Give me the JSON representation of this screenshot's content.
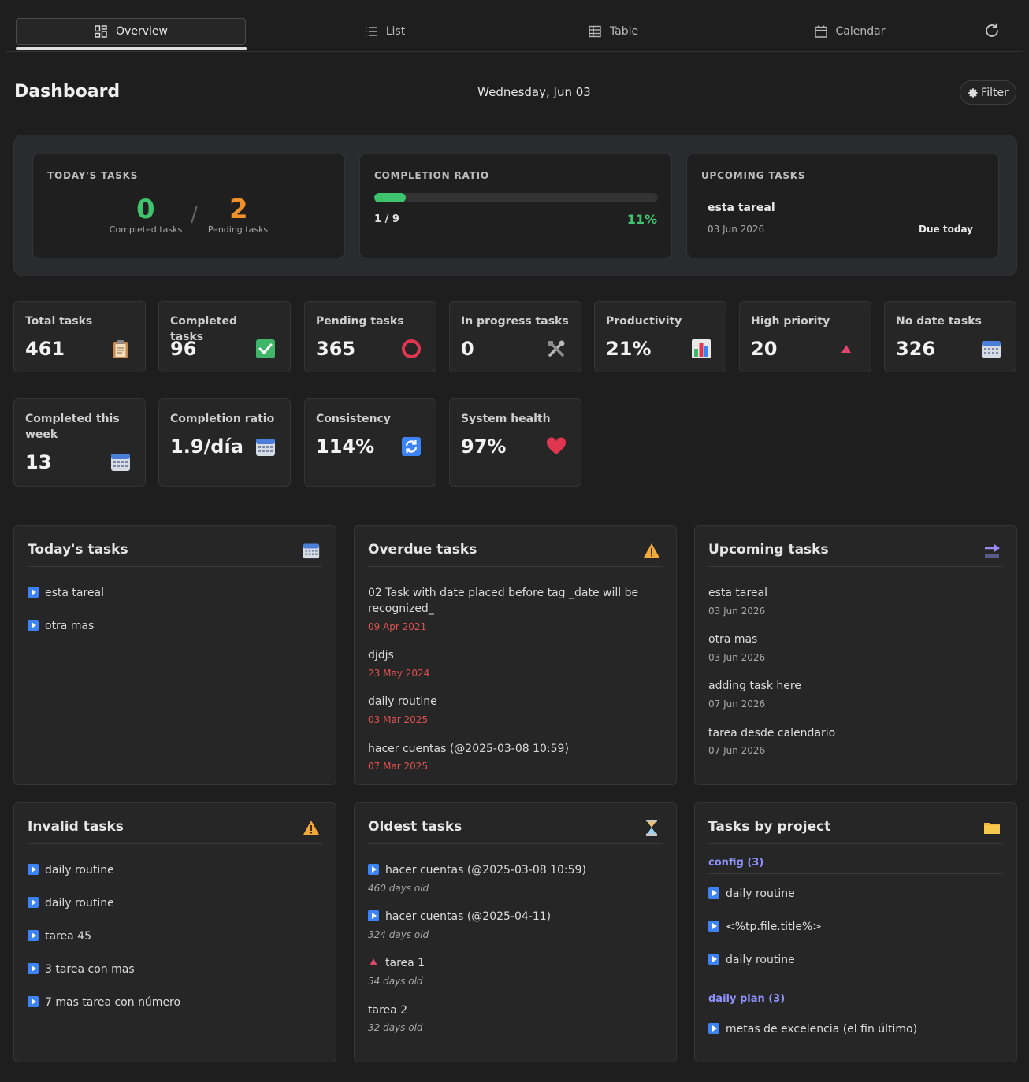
{
  "tabs": [
    {
      "label": "Overview",
      "icon": "grid-icon"
    },
    {
      "label": "List",
      "icon": "list-icon"
    },
    {
      "label": "Table",
      "icon": "table-icon"
    },
    {
      "label": "Calendar",
      "icon": "calendar-icon"
    }
  ],
  "header": {
    "title": "Dashboard",
    "date": "Wednesday, Jun 03",
    "filter_label": "Filter"
  },
  "summary": {
    "today": {
      "title": "TODAY'S TASKS",
      "completed": "0",
      "completed_label": "Completed tasks",
      "separator": "/",
      "pending": "2",
      "pending_label": "Pending tasks"
    },
    "completion": {
      "title": "COMPLETION RATIO",
      "ratio": "1 / 9",
      "percent": "11%",
      "fill_fraction": 0.11
    },
    "upcoming": {
      "title": "UPCOMING TASKS",
      "name": "esta tareal",
      "date": "03 Jun 2026",
      "due": "Due today"
    }
  },
  "stats": [
    {
      "label": "Total tasks",
      "value": "461",
      "icon": "clipboard-icon"
    },
    {
      "label": "Completed tasks",
      "value": "96",
      "icon": "check-box-icon"
    },
    {
      "label": "Pending tasks",
      "value": "365",
      "icon": "circle-icon"
    },
    {
      "label": "In progress tasks",
      "value": "0",
      "icon": "tools-icon"
    },
    {
      "label": "Productivity",
      "value": "21%",
      "icon": "bar-chart-icon"
    },
    {
      "label": "High priority",
      "value": "20",
      "icon": "triangle-icon"
    },
    {
      "label": "No date tasks",
      "value": "326",
      "icon": "calendar-icon"
    },
    {
      "label": "Completed this week",
      "value": "13",
      "icon": "calendar-icon"
    },
    {
      "label": "Completion ratio",
      "value": "1.9/día",
      "icon": "calendar-icon"
    },
    {
      "label": "Consistency",
      "value": "114%",
      "icon": "repeat-icon"
    },
    {
      "label": "System health",
      "value": "97%",
      "icon": "heart-icon"
    }
  ],
  "today_panel": {
    "title": "Today's tasks",
    "items": [
      "esta tareal",
      "otra mas"
    ]
  },
  "overdue_panel": {
    "title": "Overdue tasks",
    "items": [
      {
        "name": "02 Task with date placed before tag _date will be recognized_",
        "date": "09 Apr 2021"
      },
      {
        "name": "djdjs",
        "date": "23 May 2024"
      },
      {
        "name": "daily routine",
        "date": "03 Mar 2025"
      },
      {
        "name": "hacer cuentas (@2025-03-08 10:59)",
        "date": "07 Mar 2025"
      }
    ]
  },
  "upcoming_panel": {
    "title": "Upcoming tasks",
    "items": [
      {
        "name": "esta tareal",
        "date": "03 Jun 2026"
      },
      {
        "name": "otra mas",
        "date": "03 Jun 2026"
      },
      {
        "name": "adding task here",
        "date": "07 Jun 2026"
      },
      {
        "name": "tarea desde calendario",
        "date": "07 Jun 2026"
      }
    ]
  },
  "invalid_panel": {
    "title": "Invalid tasks",
    "items": [
      "daily routine",
      "daily routine",
      "tarea 45",
      "3 tarea con mas",
      "7 mas tarea con número"
    ]
  },
  "oldest_panel": {
    "title": "Oldest tasks",
    "items": [
      {
        "name": "hacer cuentas (@2025-03-08 10:59)",
        "age": "460 days old"
      },
      {
        "name": "hacer cuentas (@2025-04-11)",
        "age": "324 days old"
      },
      {
        "name": "tarea 1",
        "age": "54 days old"
      },
      {
        "name": "tarea 2",
        "age": "32 days old"
      }
    ]
  },
  "project_panel": {
    "title": "Tasks by project",
    "groups": [
      {
        "name": "config (3)",
        "items": [
          "daily routine",
          "<%tp.file.title%>",
          "daily routine"
        ]
      },
      {
        "name": "daily plan (3)",
        "items": [
          "metas de excelencia (el fin último)"
        ]
      }
    ]
  },
  "colors": {
    "accent_green": "#3ec46d",
    "accent_orange": "#f0902a",
    "overdue_red": "#e05252",
    "project_purple": "#8f93ff",
    "checkbox_blue": "#3b83f6"
  }
}
